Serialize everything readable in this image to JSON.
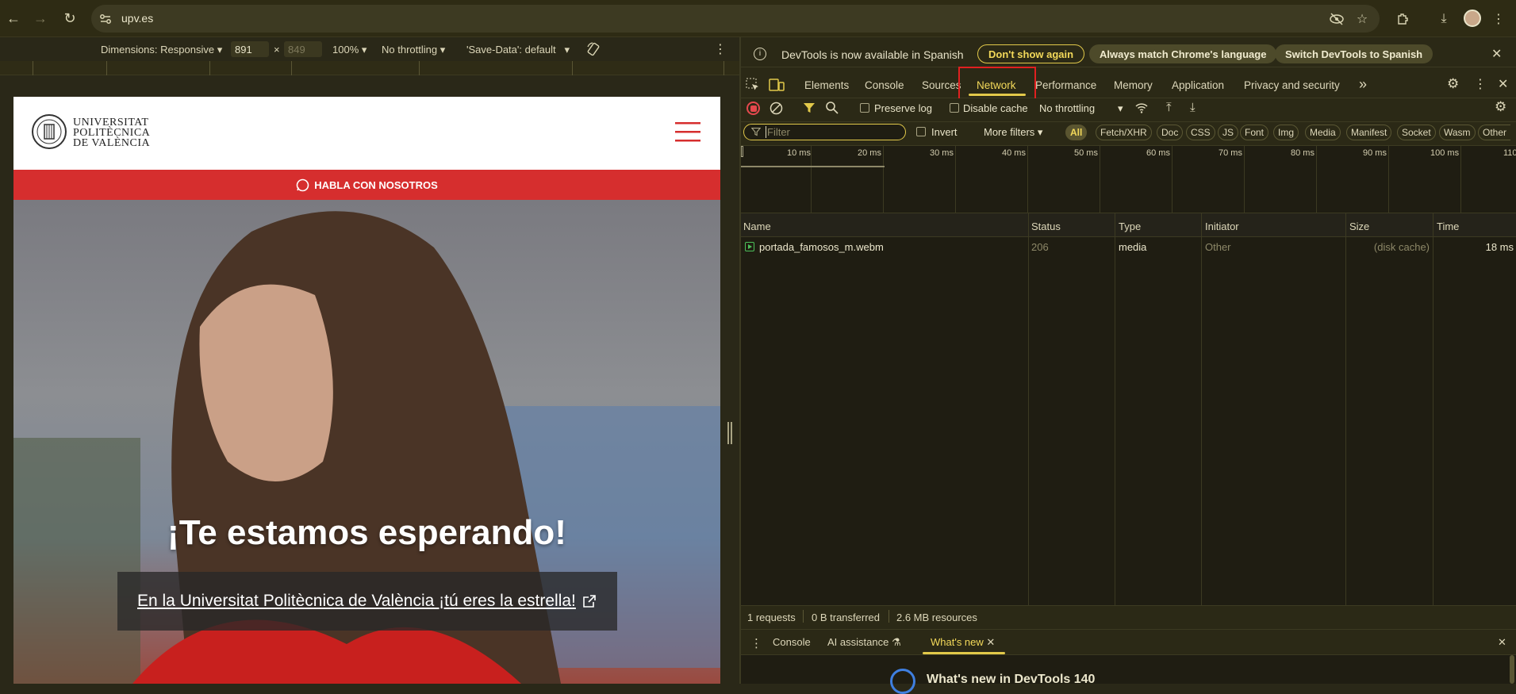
{
  "browser": {
    "url": "upv.es"
  },
  "device_toolbar": {
    "dimensions_label": "Dimensions: Responsive",
    "width": "891",
    "times": "×",
    "height": "849",
    "zoom": "100%",
    "throttling": "No throttling",
    "save_data": "'Save-Data': default"
  },
  "page": {
    "logo_line1": "UNIVERSITAT",
    "logo_line2": "POLITÈCNICA",
    "logo_line3": "DE VALÈNCIA",
    "red_bar": "HABLA CON NOSOTROS",
    "headline": "¡Te estamos esperando!",
    "hero_link": "En la Universitat Politècnica de València ¡tú eres la estrella!"
  },
  "devtools": {
    "info_text": "DevTools is now available in Spanish",
    "btn_dont_show": "Don't show again",
    "btn_match": "Always match Chrome's language",
    "btn_switch": "Switch DevTools to Spanish",
    "tabs": [
      "Elements",
      "Console",
      "Sources",
      "Network",
      "Performance",
      "Memory",
      "Application",
      "Privacy and security"
    ],
    "more_tabs": "»",
    "preserve_log": "Preserve log",
    "disable_cache": "Disable cache",
    "throttling": "No throttling",
    "filter_placeholder": "Filter",
    "invert": "Invert",
    "more_filters": "More filters",
    "chips": [
      "All",
      "Fetch/XHR",
      "Doc",
      "CSS",
      "JS",
      "Font",
      "Img",
      "Media",
      "Manifest",
      "Socket",
      "Wasm",
      "Other"
    ],
    "timeline_labels": [
      "10 ms",
      "20 ms",
      "30 ms",
      "40 ms",
      "50 ms",
      "60 ms",
      "70 ms",
      "80 ms",
      "90 ms",
      "100 ms",
      "110"
    ],
    "columns": [
      "Name",
      "Status",
      "Type",
      "Initiator",
      "Size",
      "Time"
    ],
    "rows": [
      {
        "name": "portada_famosos_m.webm",
        "status": "206",
        "type": "media",
        "initiator": "Other",
        "size": "(disk cache)",
        "time": "18 ms"
      }
    ],
    "status": {
      "requests": "1 requests",
      "transferred": "0 B transferred",
      "resources": "2.6 MB resources"
    },
    "drawer": {
      "tabs": [
        "Console",
        "AI assistance",
        "What's new"
      ],
      "whats_new_title": "What's new in DevTools 140"
    }
  },
  "colors": {
    "accent": "#e2c94a",
    "upv_red": "#d62e2e",
    "highlight_box": "#e02020",
    "record": "#e5484d"
  }
}
